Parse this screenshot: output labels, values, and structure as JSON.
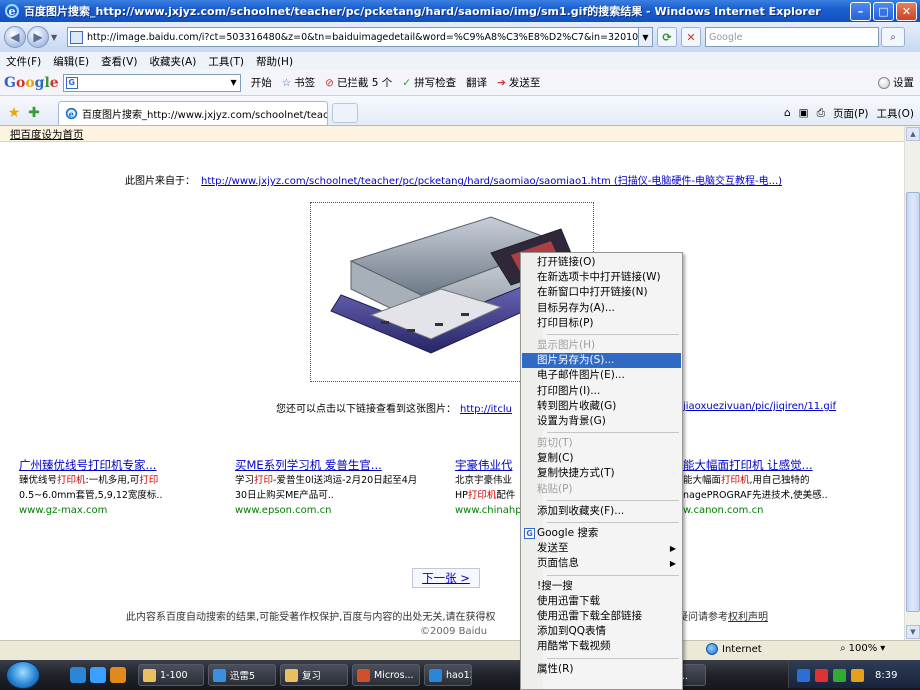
{
  "window": {
    "title": "百度图片搜索_http://www.jxjyz.com/schoolnet/teacher/pc/pcketang/hard/saomiao/img/sm1.gif的搜索结果 - Windows Internet Explorer"
  },
  "address_bar": {
    "url": "http://image.baidu.com/i?ct=503316480&z=0&tn=baiduimagedetail&word=%C9%A8%C3%E8%D2%C7&in=32010&cl=2&l",
    "search_placeholder": "Google"
  },
  "menu_bar": [
    "文件(F)",
    "编辑(E)",
    "查看(V)",
    "收藏夹(A)",
    "工具(T)",
    "帮助(H)"
  ],
  "google_toolbar": {
    "logo": "Google",
    "search_prefix": "G",
    "items": [
      "开始",
      "书签",
      "已拦截 5 个",
      "拼写检查",
      "翻译",
      "发送至"
    ],
    "settings": "设置"
  },
  "tab": {
    "title": "百度图片搜索_http://www.jxjyz.com/schoolnet/teac..."
  },
  "command_bar": {
    "page": "页面(P)",
    "tools": "工具(O)"
  },
  "page": {
    "notice_link": "把百度设为首页",
    "source_label": "此图片来自于：",
    "source_link": "http://www.jxjyz.com/schoolnet/teacher/pc/pcketang/hard/saomiao/saomiao1.htm (扫描仪-电脑硬件-电脑交互教程-电...)",
    "more_label": "您还可以点击以下链接查看到这张图片：",
    "more_link": "http://itclu",
    "more_link_tail": "jiaoxuezivuan/pic/jiqiren/11.gif",
    "ads": [
      {
        "title": "广州臻优线号打印机专家...",
        "desc_parts": [
          "臻优线号",
          "打印机",
          ":一机多用,可",
          "打印"
        ],
        "desc2": "0.5~6.0mm套管,5,9,12宽度标..",
        "url": "www.gz-max.com"
      },
      {
        "title": "买ME系列学习机 爱普生官...",
        "desc_parts": [
          "学习",
          "打印",
          "-爱普生0l送鸿运-2月20日起至4月",
          ""
        ],
        "desc2": "30日止购买ME产品可..",
        "url": "www.epson.com.cn"
      },
      {
        "title": "宇豪伟业代",
        "desc_parts": [
          "北京宇豪伟业",
          "",
          "",
          ""
        ],
        "desc2_parts": [
          "HP",
          "打印机",
          "配件"
        ],
        "url": "www.chinahp"
      },
      {
        "title": "能大幅面打印机 让感觉...",
        "desc_parts": [
          "能大幅面",
          "打印机",
          ",用自己独特的",
          ""
        ],
        "desc2": "nagePROGRAF先进技术,使美感..",
        "url": "w.canon.com.cn"
      }
    ],
    "next_page": "下一张 >",
    "footer": "此内容系百度自动搜索的结果,可能受著作权保护,百度与内容的出处无关,请在获得权",
    "footer_tail_prefix": "疑问请参考",
    "footer_tail_link": "权利声明",
    "copyright": "©2009 Baidu"
  },
  "context_menu": {
    "items": [
      {
        "label": "打开链接(O)",
        "disabled": false
      },
      {
        "label": "在新选项卡中打开链接(W)",
        "disabled": false
      },
      {
        "label": "在新窗口中打开链接(N)",
        "disabled": false
      },
      {
        "label": "目标另存为(A)...",
        "disabled": false
      },
      {
        "label": "打印目标(P)",
        "disabled": false
      },
      {
        "sep": true
      },
      {
        "label": "显示图片(H)",
        "disabled": true
      },
      {
        "label": "图片另存为(S)...",
        "disabled": false,
        "selected": true
      },
      {
        "label": "电子邮件图片(E)...",
        "disabled": false
      },
      {
        "label": "打印图片(I)...",
        "disabled": false
      },
      {
        "label": "转到图片收藏(G)",
        "disabled": false
      },
      {
        "label": "设置为背景(G)",
        "disabled": false
      },
      {
        "sep": true
      },
      {
        "label": "剪切(T)",
        "disabled": true
      },
      {
        "label": "复制(C)",
        "disabled": false
      },
      {
        "label": "复制快捷方式(T)",
        "disabled": false
      },
      {
        "label": "粘贴(P)",
        "disabled": true
      },
      {
        "sep": true
      },
      {
        "label": "添加到收藏夹(F)...",
        "disabled": false
      },
      {
        "sep": true
      },
      {
        "label": "Google 搜索",
        "disabled": false,
        "google": true
      },
      {
        "label": "发送至",
        "disabled": false,
        "submenu": true
      },
      {
        "label": "页面信息",
        "disabled": false,
        "submenu": true
      },
      {
        "sep": true
      },
      {
        "label": "!搜一搜",
        "disabled": false
      },
      {
        "label": "使用迅雷下载",
        "disabled": false
      },
      {
        "label": "使用迅雷下载全部链接",
        "disabled": false
      },
      {
        "label": "添加到QQ表情",
        "disabled": false
      },
      {
        "label": "用酷常下载视频",
        "disabled": false
      },
      {
        "sep": true
      },
      {
        "label": "属性(R)",
        "disabled": false
      }
    ]
  },
  "status_bar": {
    "zone": "Internet",
    "zoom": "100%"
  },
  "taskbar": {
    "tasks": [
      "1-100",
      "迅雷5",
      "复习",
      "Micros...",
      "hao12",
      "百度..."
    ],
    "clock": "8:39"
  },
  "colors": {
    "link": "#0000cc",
    "highlight": "#cc0000",
    "url_green": "#008000",
    "menu_selected": "#316ac5"
  }
}
